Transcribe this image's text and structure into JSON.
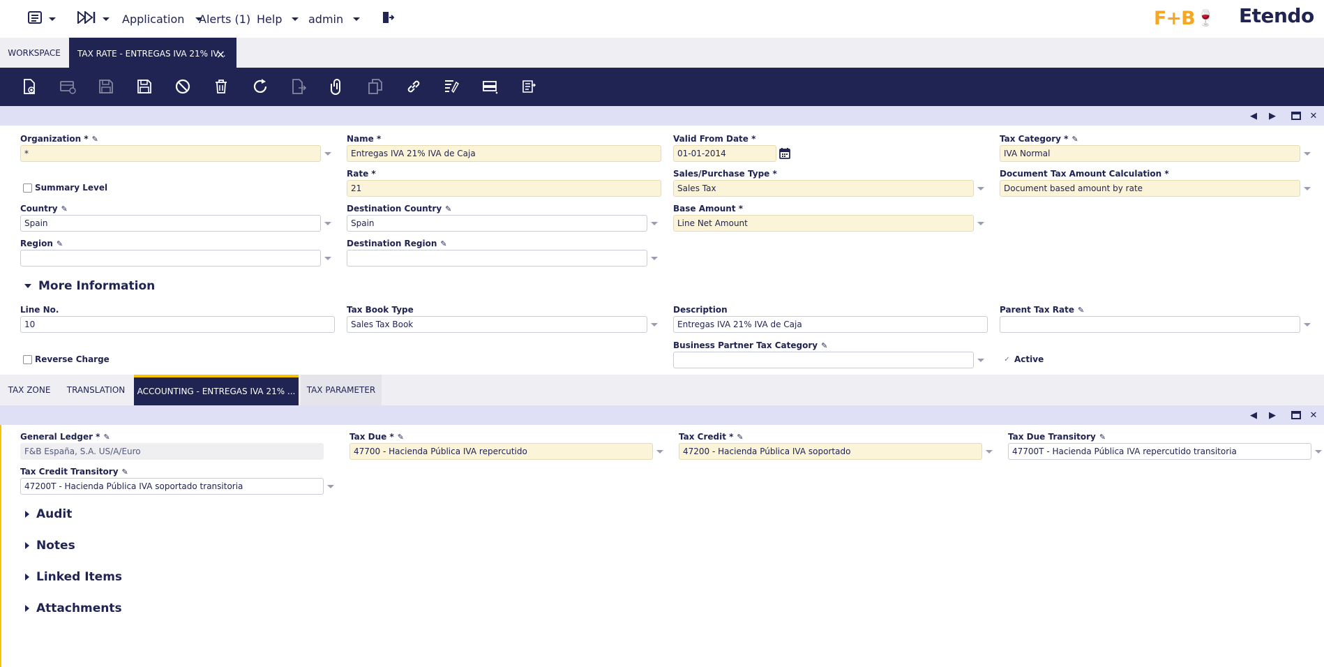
{
  "topbar": {
    "application": "Application",
    "alerts": "Alerts (1)",
    "help": "Help",
    "user": "admin",
    "logo_fb": "F+B",
    "logo_etendo": "Etendo"
  },
  "main_tabs": {
    "workspace": "WORKSPACE",
    "active": "TAX RATE - ENTREGAS IVA 21% IV...",
    "close": "×"
  },
  "form": {
    "organization": {
      "label": "Organization *",
      "value": "*"
    },
    "name": {
      "label": "Name *",
      "value": "Entregas IVA 21% IVA de Caja"
    },
    "valid_from": {
      "label": "Valid From Date *",
      "value": "01-01-2014"
    },
    "tax_category": {
      "label": "Tax Category *",
      "value": "IVA Normal"
    },
    "summary_level": {
      "label": "Summary Level"
    },
    "rate": {
      "label": "Rate *",
      "value": "21"
    },
    "sales_purchase_type": {
      "label": "Sales/Purchase Type *",
      "value": "Sales Tax"
    },
    "doc_tax_calc": {
      "label": "Document Tax Amount Calculation *",
      "value": "Document based amount by rate"
    },
    "country": {
      "label": "Country",
      "value": "Spain"
    },
    "dest_country": {
      "label": "Destination Country",
      "value": "Spain"
    },
    "base_amount": {
      "label": "Base Amount *",
      "value": "Line Net Amount"
    },
    "region": {
      "label": "Region",
      "value": ""
    },
    "dest_region": {
      "label": "Destination Region",
      "value": ""
    }
  },
  "more_info": {
    "title": "More Information",
    "line_no": {
      "label": "Line No.",
      "value": "10"
    },
    "tax_book_type": {
      "label": "Tax Book Type",
      "value": "Sales Tax Book"
    },
    "description": {
      "label": "Description",
      "value": "Entregas IVA 21% IVA de Caja"
    },
    "parent_tax_rate": {
      "label": "Parent Tax Rate",
      "value": ""
    },
    "reverse_charge": {
      "label": "Reverse Charge"
    },
    "bp_tax_category": {
      "label": "Business Partner Tax Category",
      "value": ""
    },
    "active": {
      "label": "Active",
      "check": "✓"
    }
  },
  "sub_tabs": {
    "tax_zone": "TAX ZONE",
    "translation": "TRANSLATION",
    "accounting": "ACCOUNTING - ENTREGAS IVA 21% ...",
    "tax_parameter": "TAX PARAMETER"
  },
  "accounting": {
    "general_ledger": {
      "label": "General Ledger *",
      "value": "F&B España, S.A. US/A/Euro"
    },
    "tax_due": {
      "label": "Tax Due *",
      "value": "47700 - Hacienda Pública IVA repercutido"
    },
    "tax_credit": {
      "label": "Tax Credit *",
      "value": "47200 - Hacienda Pública IVA soportado"
    },
    "tax_due_transitory": {
      "label": "Tax Due Transitory",
      "value": "47700T - Hacienda Pública IVA repercutido transitoria"
    },
    "tax_credit_transitory": {
      "label": "Tax Credit Transitory",
      "value": "47200T - Hacienda Pública IVA soportado transitoria"
    }
  },
  "sections": {
    "audit": "Audit",
    "notes": "Notes",
    "linked_items": "Linked Items",
    "attachments": "Attachments"
  },
  "glyphs": {
    "pen": "✎",
    "prev": "◀",
    "next": "▶",
    "maximize": "▬",
    "close": "✕"
  }
}
